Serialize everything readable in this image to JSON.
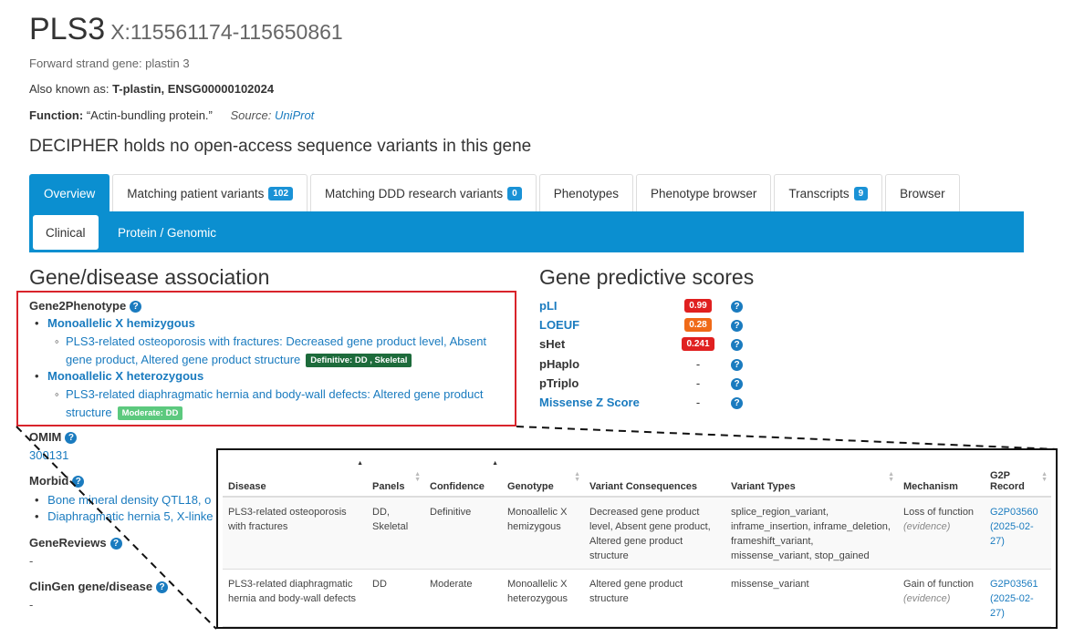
{
  "gene": {
    "symbol": "PLS3",
    "coords": "X:115561174-115650861",
    "strand_text": "Forward strand gene: plastin 3",
    "aka_label": "Also known as:",
    "aka_value": "T-plastin, ENSG00000102024",
    "function_label": "Function:",
    "function_value": "“Actin-bundling protein.”",
    "source_label": "Source:",
    "source_value": "UniProt",
    "notice": "DECIPHER holds no open-access sequence variants in this gene"
  },
  "tabs": [
    {
      "label": "Overview",
      "count": ""
    },
    {
      "label": "Matching patient variants",
      "count": "102"
    },
    {
      "label": "Matching DDD research variants",
      "count": "0"
    },
    {
      "label": "Phenotypes",
      "count": ""
    },
    {
      "label": "Phenotype browser",
      "count": ""
    },
    {
      "label": "Transcripts",
      "count": "9"
    },
    {
      "label": "Browser",
      "count": ""
    }
  ],
  "subtabs": [
    "Clinical",
    "Protein / Genomic"
  ],
  "gene_disease": {
    "heading": "Gene/disease association",
    "g2p_title": "Gene2Phenotype",
    "entries": [
      {
        "genotype": "Monoallelic X hemizygous",
        "disease": "PLS3-related osteoporosis with fractures: Decreased gene product level, Absent gene product, Altered gene product structure",
        "badge": "Definitive: DD , Skeletal"
      },
      {
        "genotype": "Monoallelic X heterozygous",
        "disease": "PLS3-related diaphragmatic hernia and body-wall defects: Altered gene product structure",
        "badge": "Moderate: DD"
      }
    ],
    "omim_title": "OMIM",
    "omim_value": "300131",
    "morbid_title": "Morbid",
    "morbid_items": [
      "Bone mineral density QTL18, o",
      "Diaphragmatic hernia 5, X-linke"
    ],
    "genereviews_title": "GeneReviews",
    "genereviews_value": "-",
    "clingen_title": "ClinGen gene/disease",
    "clingen_value": "-"
  },
  "scores": {
    "heading": "Gene predictive scores",
    "rows": [
      {
        "label": "pLI",
        "value": "0.99",
        "color": "#e02020",
        "link": true
      },
      {
        "label": "LOEUF",
        "value": "0.28",
        "color": "#f06a18",
        "link": true
      },
      {
        "label": "sHet",
        "value": "0.241",
        "color": "#e02020",
        "link": false
      },
      {
        "label": "pHaplo",
        "value": "-",
        "color": "",
        "link": false
      },
      {
        "label": "pTriplo",
        "value": "-",
        "color": "",
        "link": false
      },
      {
        "label": "Missense Z Score",
        "value": "-",
        "color": "",
        "link": true
      }
    ]
  },
  "g2p_table": {
    "headers": [
      "Disease",
      "Panels",
      "Confidence",
      "Genotype",
      "Variant Consequences",
      "Variant Types",
      "Mechanism",
      "G2P Record"
    ],
    "rows": [
      {
        "disease": "PLS3-related osteoporosis with fractures",
        "panels": "DD, Skeletal",
        "confidence": "Definitive",
        "genotype": "Monoallelic X hemizygous",
        "consequences": "Decreased gene product level, Absent gene product, Altered gene product structure",
        "types": "splice_region_variant, inframe_insertion, inframe_deletion, frameshift_variant, missense_variant, stop_gained",
        "mechanism": "Loss of function",
        "evidence": "(evidence)",
        "record": "G2P03560",
        "date": "(2025-02-27)"
      },
      {
        "disease": "PLS3-related diaphragmatic hernia and body-wall defects",
        "panels": "DD",
        "confidence": "Moderate",
        "genotype": "Monoallelic X heterozygous",
        "consequences": "Altered gene product structure",
        "types": "missense_variant",
        "mechanism": "Gain of function",
        "evidence": "(evidence)",
        "record": "G2P03561",
        "date": "(2025-02-27)"
      }
    ]
  }
}
